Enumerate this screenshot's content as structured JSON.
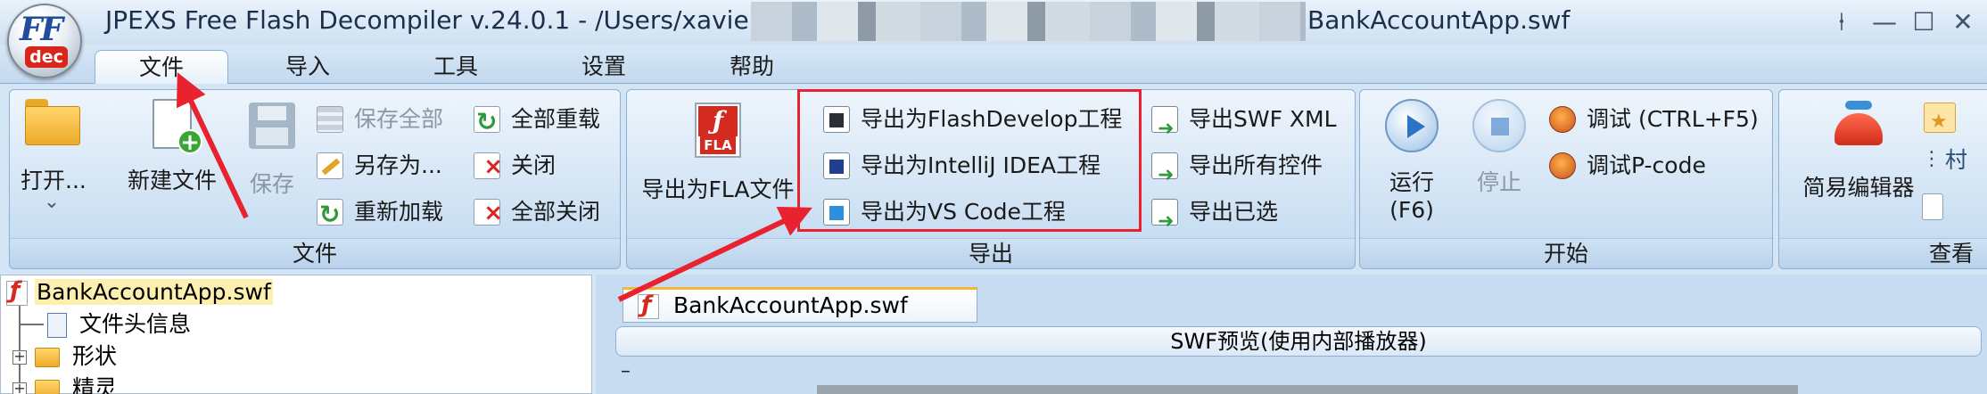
{
  "title_bar": {
    "title_prefix": "JPEXS Free Flash Decompiler v.24.0.1 - /Users/xavier/",
    "title_suffix": "BankAccountApp.swf",
    "logo_text": "FF",
    "logo_badge": "dec",
    "pin_icon": "⍿",
    "minimize_icon": "—",
    "maximize_icon": "☐",
    "close_icon": "✕"
  },
  "menu_tabs": [
    {
      "label": "文件",
      "active": true
    },
    {
      "label": "导入"
    },
    {
      "label": "工具"
    },
    {
      "label": "设置"
    },
    {
      "label": "帮助"
    }
  ],
  "ribbon": {
    "file_group": {
      "title": "文件",
      "open_label": "打开...",
      "open_dropdown": "⌄",
      "new_file_label": "新建文件",
      "save_label": "保存",
      "save_all_label": "保存全部",
      "save_as_label": "另存为...",
      "reload_label": "重新加载",
      "reload_all_label": "全部重载",
      "close_label": "关闭",
      "close_all_label": "全部关闭"
    },
    "export_group": {
      "title": "导出",
      "export_fla_label": "导出为FLA文件",
      "fla_badge": "FLA",
      "fla_glyph": "ƒ",
      "export_flashdevelop_label": "导出为FlashDevelop工程",
      "export_intellij_label": "导出为IntelliJ IDEA工程",
      "export_vscode_label": "导出为VS Code工程",
      "export_swf_xml_label": "导出SWF XML",
      "export_all_label": "导出所有控件",
      "export_selected_label": "导出已选"
    },
    "start_group": {
      "title": "开始",
      "run_label": "运行",
      "run_shortcut": "(F6)",
      "stop_label": "停止",
      "debug_label": "调试 (CTRL+F5)",
      "debug_pcode_label": "调试P-code"
    },
    "view_group": {
      "title": "查看",
      "easy_editor_label": "简易编辑器",
      "truncated_label": "村"
    }
  },
  "tree": {
    "root_label": "BankAccountApp.swf",
    "items": [
      {
        "label": "文件头信息"
      },
      {
        "label": "形状"
      },
      {
        "label": "精灵"
      }
    ],
    "expand_symbol": "+"
  },
  "preview": {
    "tab_label": "BankAccountApp.swf",
    "header": "SWF预览(使用内部播放器)",
    "dash": "–"
  },
  "colors": {
    "highlight_red": "#e8232f",
    "ribbon_blue": "#c9def2",
    "flash_red": "#d42b20"
  }
}
